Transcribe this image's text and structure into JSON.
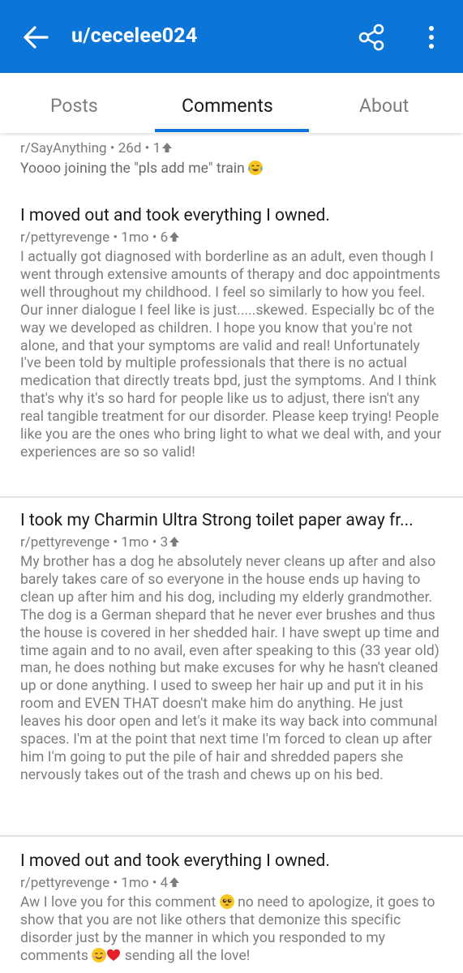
{
  "header": {
    "title": "u/cecelee024",
    "back_icon": "back-arrow-icon",
    "share_icon": "share-icon",
    "more_icon": "more-vert-icon",
    "bg_color": "#0c75d8"
  },
  "tabs": [
    {
      "label": "Posts",
      "active": false
    },
    {
      "label": "Comments",
      "active": true
    },
    {
      "label": "About",
      "active": false
    }
  ],
  "comments": [
    {
      "title": "",
      "subreddit": "r/SayAnything",
      "age": "26d",
      "score": "1",
      "body": "Yoooo joining the \"pls add me\" train",
      "emoji": "face-with-tears-of-joy"
    },
    {
      "title": "I moved out and took everything I owned.",
      "subreddit": "r/pettyrevenge",
      "age": "1mo",
      "score": "6",
      "body": "I actually got diagnosed with borderline as an adult, even though I went through extensive amounts of therapy and doc appointments well throughout my childhood. I feel so similarly to how you feel. Our inner dialogue I feel like is just.....skewed. Especially bc of the way we developed as children. I hope you know that you're not alone, and that your symptoms are valid and real! Unfortunately I've been told by multiple professionals that there is no actual medication that directly treats bpd, just the symptoms. And I think that's why it's so hard for people like us to adjust, there isn't any real tangible treatment for our disorder. Please keep trying! People like you are the ones who bring light to what we deal with, and your experiences are so so valid!"
    },
    {
      "title": "I took my Charmin Ultra Strong toilet paper away fr...",
      "subreddit": "r/pettyrevenge",
      "age": "1mo",
      "score": "3",
      "body": "My brother has a dog he absolutely never cleans up after and also barely takes care of so everyone in the house ends up having to clean up after him and his dog, including my elderly grandmother. The dog is a German shepard that he never ever brushes and thus the house is covered in her shedded hair. I have swept up time and time again and to no avail, even after speaking to this (33 year old) man, he does nothing but make excuses for why he hasn't cleaned up or done anything. I used to sweep her hair up and put it in his room and EVEN THAT doesn't make him do anything. He just leaves his door open and let's it make its way back into communal spaces. I'm at the point that next time I'm forced to clean up after him I'm going to put the pile of hair and shredded papers she nervously takes out of the trash and chews up on his bed."
    },
    {
      "title": "I moved out and took everything I owned.",
      "subreddit": "r/pettyrevenge",
      "age": "1mo",
      "score": "4",
      "body_part1": "Aw I love you for this comment",
      "body_part2": "no need to apologize, it goes to show that you are not like others that demonize this specific disorder just by the manner in which you responded to my comments",
      "body_part3": "sending all the love!",
      "emoji1": "pleading-face",
      "emoji2": "smiling-face",
      "emoji3": "red-heart"
    }
  ],
  "separator": "•"
}
